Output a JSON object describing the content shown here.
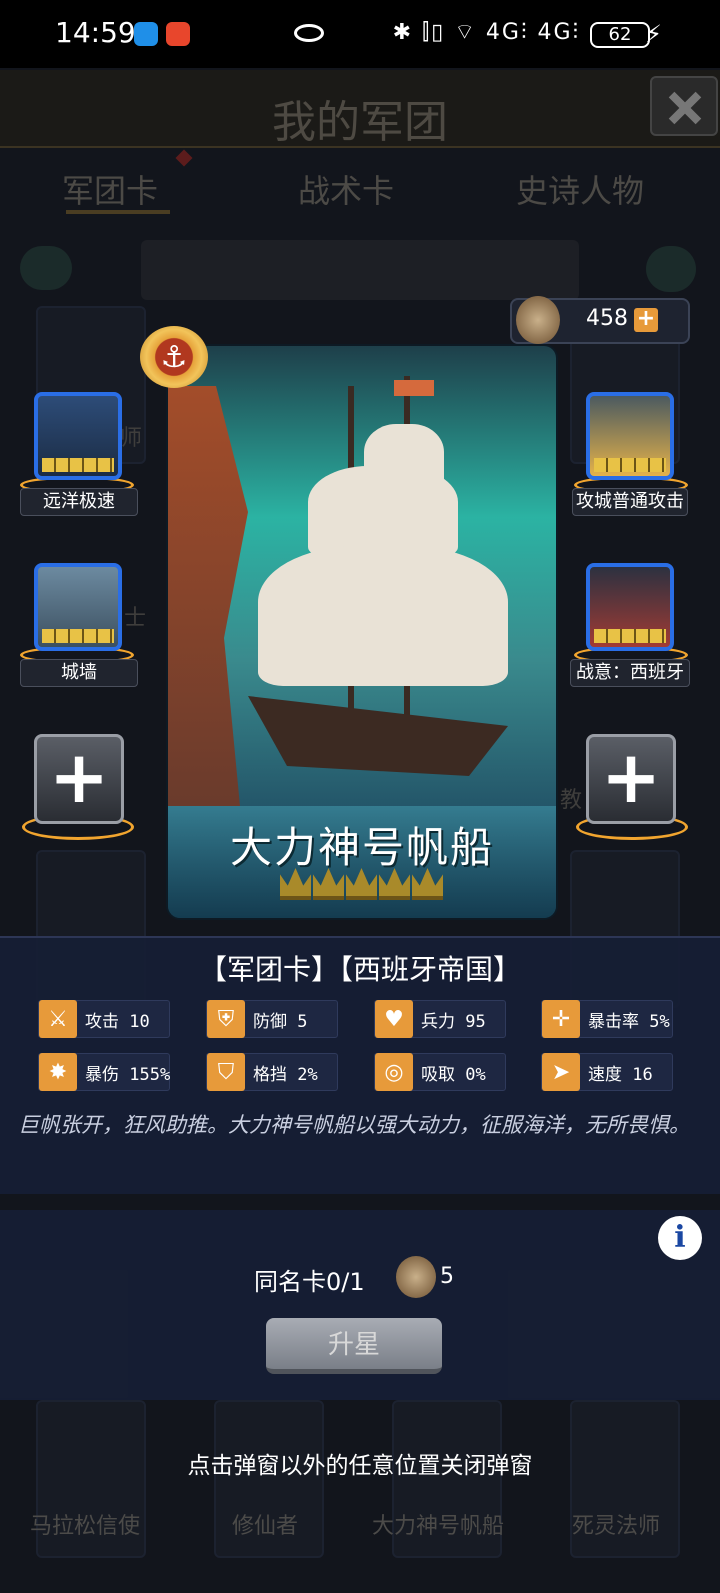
{
  "status_bar": {
    "time": "14:59",
    "icons_right": "✱ ⫿▯ ⌔ 4G⫶ 4G⫶",
    "battery": "62"
  },
  "background": {
    "title": "我的军团",
    "tabs": [
      "军团卡",
      "战术卡",
      "史诗人物"
    ],
    "side_label_1": "师",
    "side_label_2": "士",
    "side_label_3": "教",
    "bottom_cards": [
      "马拉松信使",
      "修仙者",
      "大力神号帆船",
      "死灵法师"
    ]
  },
  "currency": {
    "value": "458",
    "plus": "+"
  },
  "card": {
    "name": "大力神号帆船",
    "stars": 5,
    "faction_badge": "⚓",
    "tags": "【军团卡】【西班牙帝国】",
    "description": "巨帆张开，狂风助推。大力神号帆船以强大动力，征服海洋，无所畏惧。"
  },
  "skills": {
    "left": [
      {
        "label": "远洋极速"
      },
      {
        "label": "城墙"
      }
    ],
    "right": [
      {
        "label": "攻城普通攻击"
      },
      {
        "label": "战意：西班牙"
      }
    ],
    "add_label": "+"
  },
  "stats": [
    {
      "icon": "sword-icon",
      "glyph": "⚔",
      "text": "攻击 10"
    },
    {
      "icon": "shield-icon",
      "glyph": "⛨",
      "text": "防御 5"
    },
    {
      "icon": "heart-icon",
      "glyph": "♥",
      "text": "兵力 95"
    },
    {
      "icon": "crosshair-icon",
      "glyph": "✛",
      "text": "暴击率 5%"
    },
    {
      "icon": "burst-icon",
      "glyph": "✸",
      "text": "暴伤 155%"
    },
    {
      "icon": "parry-icon",
      "glyph": "⛉",
      "text": "格挡 2%"
    },
    {
      "icon": "absorb-icon",
      "glyph": "◎",
      "text": "吸取 0%"
    },
    {
      "icon": "boot-icon",
      "glyph": "➤",
      "text": "速度 16"
    }
  ],
  "upgrade": {
    "same_card": "同名卡0/1",
    "medal_count": "5",
    "button": "升星",
    "info": "i"
  },
  "close_hint": "点击弹窗以外的任意位置关闭弹窗",
  "colors": {
    "accent_orange": "#e79a3a",
    "skill_border_blue": "#2a6ee6",
    "panel_bg": "#161e34"
  }
}
